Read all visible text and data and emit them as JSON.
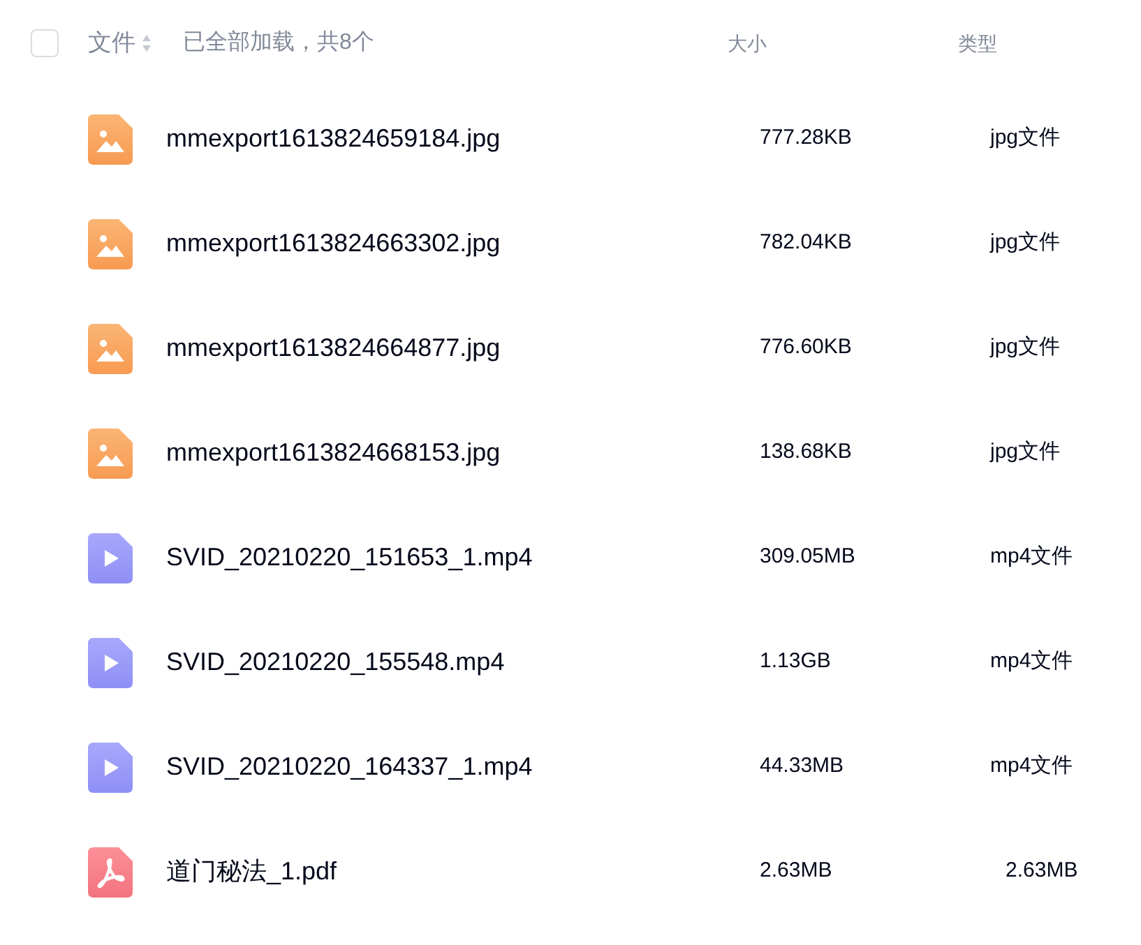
{
  "header": {
    "select_all": {
      "checked": false
    },
    "name_column": "文件",
    "status": "已全部加载，共8个",
    "size_column": "大小",
    "type_column": "类型"
  },
  "files": [
    {
      "kind": "image",
      "name": "mmexport1613824659184.jpg",
      "size": "777.28KB",
      "type": "jpg文件"
    },
    {
      "kind": "image",
      "name": "mmexport1613824663302.jpg",
      "size": "782.04KB",
      "type": "jpg文件"
    },
    {
      "kind": "image",
      "name": "mmexport1613824664877.jpg",
      "size": "776.60KB",
      "type": "jpg文件"
    },
    {
      "kind": "image",
      "name": "mmexport1613824668153.jpg",
      "size": "138.68KB",
      "type": "jpg文件"
    },
    {
      "kind": "video",
      "name": "SVID_20210220_151653_1.mp4",
      "size": "309.05MB",
      "type": "mp4文件"
    },
    {
      "kind": "video",
      "name": "SVID_20210220_155548.mp4",
      "size": "1.13GB",
      "type": "mp4文件"
    },
    {
      "kind": "video",
      "name": "SVID_20210220_164337_1.mp4",
      "size": "44.33MB",
      "type": "mp4文件"
    },
    {
      "kind": "pdf",
      "name": "道门秘法_1.pdf",
      "size": "2.63MB",
      "type": "2.63MB"
    }
  ]
}
